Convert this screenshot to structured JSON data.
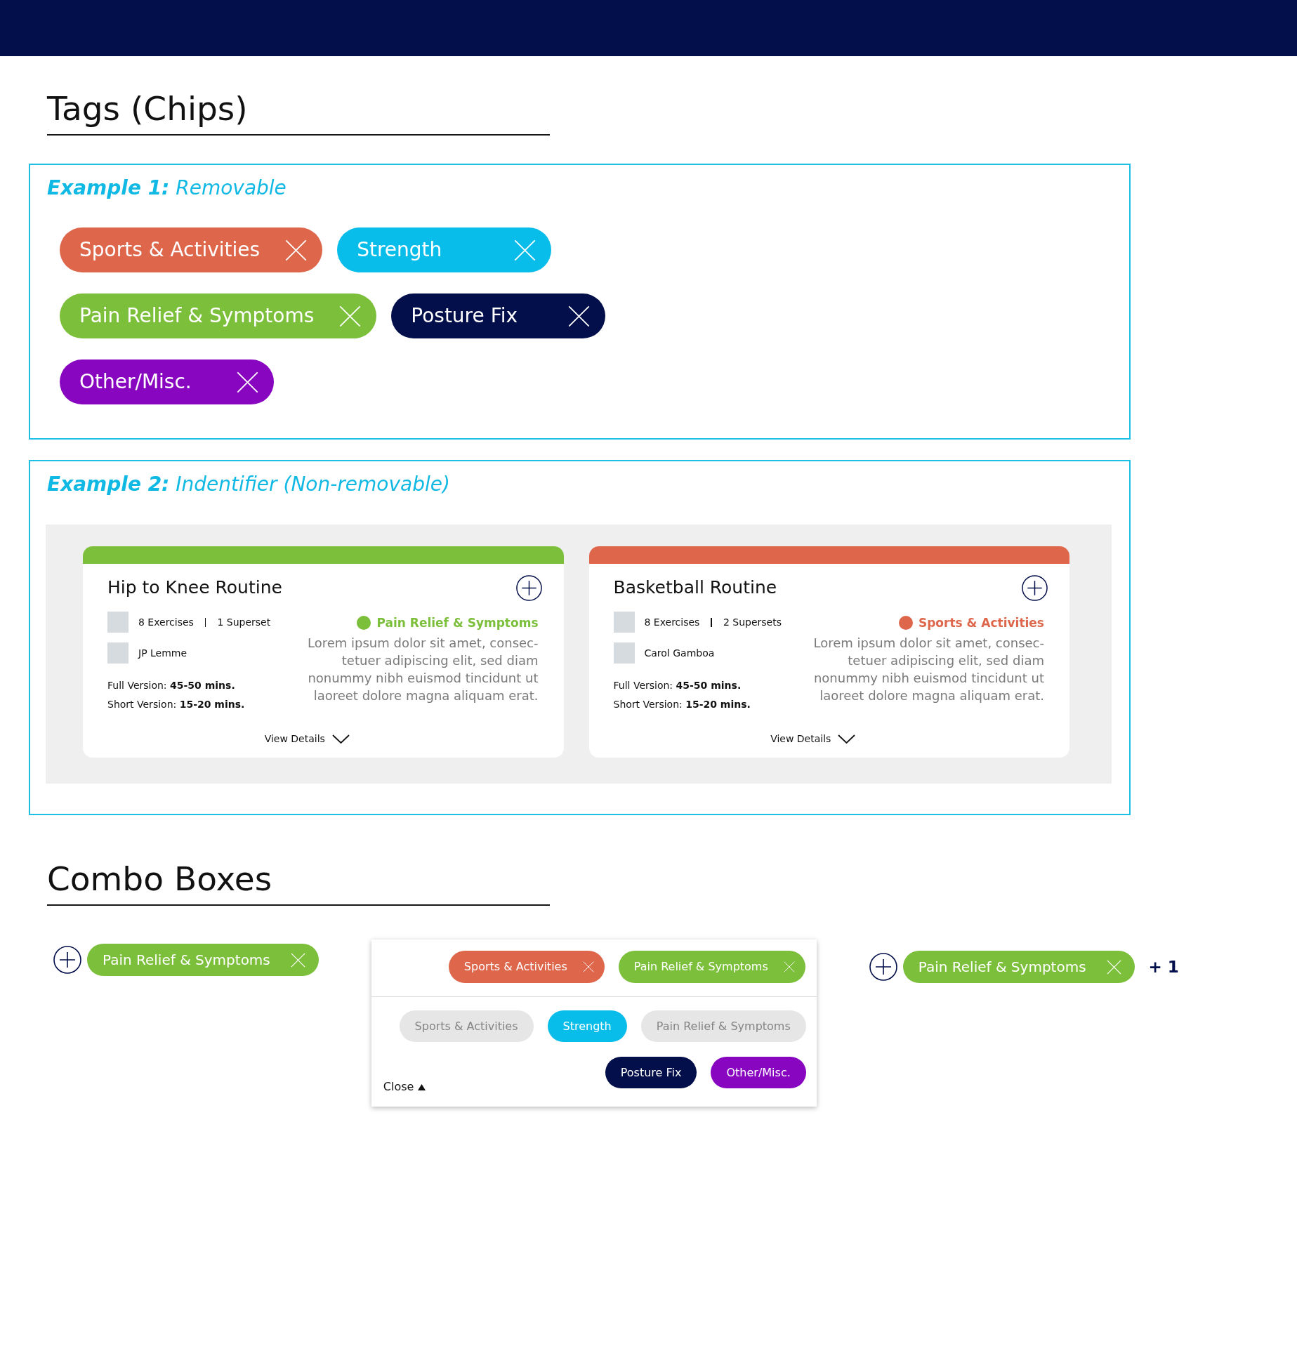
{
  "tags_section": {
    "title": "Tags (Chips)",
    "examples": [
      {
        "kind": "removable",
        "title": "**Example 1:** Removable",
        "chips": [
          {
            "label": "Sports & Activities",
            "color": "#dd664b"
          },
          {
            "label": "Strength",
            "color": "#08bde9"
          },
          {
            "label": "Pain Relief & Symptoms",
            "color": "#7cbf3b"
          },
          {
            "label": "Posture Fix",
            "color": "#030f4a"
          },
          {
            "label": "Other/Misc.",
            "color": "#8906c0"
          }
        ]
      },
      {
        "kind": "cards",
        "title": "**Example 2:** Indentifier (Non-removable)",
        "cards": [
          {
            "title": "Hip to Knee Routine",
            "exercises": "8 Exercises",
            "supersets": "1 Superset",
            "author": "JP Lemme",
            "full_version": "Full Version: **45-50 mins.**",
            "short_version": "Short Version: **15-20 mins.**",
            "category": "Pain Relief & Symptoms",
            "color": "#7cbf3b",
            "description": "Lorem ipsum dolor sit amet, consec-\ntetuer adipiscing elit, sed diam\nnonummy nibh euismod tincidunt ut\nlaoreet dolore magna aliquam erat.",
            "action": "View Details"
          },
          {
            "title": "Basketball Routine",
            "exercises": "8 Exercises",
            "supersets": "2 Supersets",
            "author": "Carol Gamboa",
            "full_version": "Full Version: **45-50 mins.**",
            "short_version": "Short Version: **15-20 mins.**",
            "category": "Sports & Activities",
            "color": "#dd664b",
            "description": "Lorem ipsum dolor sit amet, consec-\ntetuer adipiscing elit, sed diam\nnonummy nibh euismod tincidunt ut\nlaoreet dolore magna aliquam erat.",
            "action": "View Details"
          }
        ]
      }
    ]
  },
  "combo_section": {
    "title": "Combo Boxes",
    "combos": [
      {
        "kind": "inline",
        "chips": [
          {
            "label": "Pain Relief & Symptoms",
            "color": "#7cbf3b"
          }
        ]
      },
      {
        "kind": "dropdown",
        "chips": [
          {
            "label": "Sports & Activities",
            "color": "#dd664b"
          },
          {
            "label": "Pain Relief & Symptoms",
            "color": "#7cbf3b"
          }
        ],
        "options": [
          {
            "label": "Sports & Activities",
            "disabled": true
          },
          {
            "label": "Strength",
            "color": "#08bde9",
            "disabled": false
          },
          {
            "label": "Pain Relief & Symptoms",
            "disabled": true
          },
          {
            "label": "Posture Fix",
            "color": "#030f4a",
            "disabled": false
          },
          {
            "label": "Other/Misc.",
            "color": "#8906c0",
            "disabled": false
          }
        ],
        "close": "Close"
      },
      {
        "kind": "inline",
        "chips": [
          {
            "label": "Pain Relief & Symptoms",
            "color": "#7cbf3b"
          }
        ],
        "more": "+ 1"
      }
    ]
  }
}
